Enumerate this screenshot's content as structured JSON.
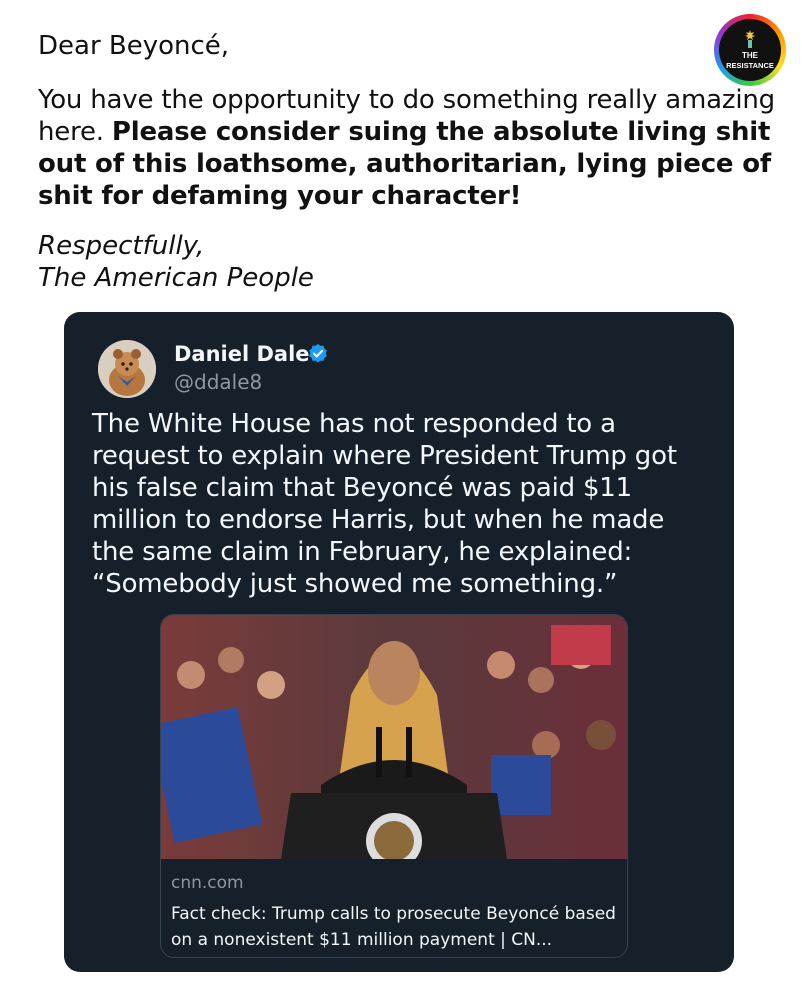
{
  "post": {
    "salutation": "Dear Beyoncé,",
    "body_regular": "You have the opportunity to do something really amazing here. ",
    "body_bold": "Please consider suing the absolute living shit out of this loathsome, authoritarian, lying piece of shit for defaming your character!",
    "closing_line1": "Respectfully,",
    "closing_line2": "The American People"
  },
  "badge": {
    "line1": "THE",
    "line2": "RESISTANCE"
  },
  "tweet": {
    "author_name": "Daniel Dale",
    "author_handle": "@ddale8",
    "verified": true,
    "verified_color": "#1d9bf0",
    "text": "The White House has not responded to a request to explain where President Trump got his false claim that Beyoncé was paid $11 million to endorse Harris, but when he made the same claim in February, he explained: “Somebody just showed me something.”",
    "link": {
      "domain": "cnn.com",
      "title": "Fact check: Trump calls to prosecute Beyoncé based on a nonexistent $11 million payment | CN..."
    }
  },
  "colors": {
    "card_background": "#15202b",
    "secondary_text": "#8b98a5"
  }
}
